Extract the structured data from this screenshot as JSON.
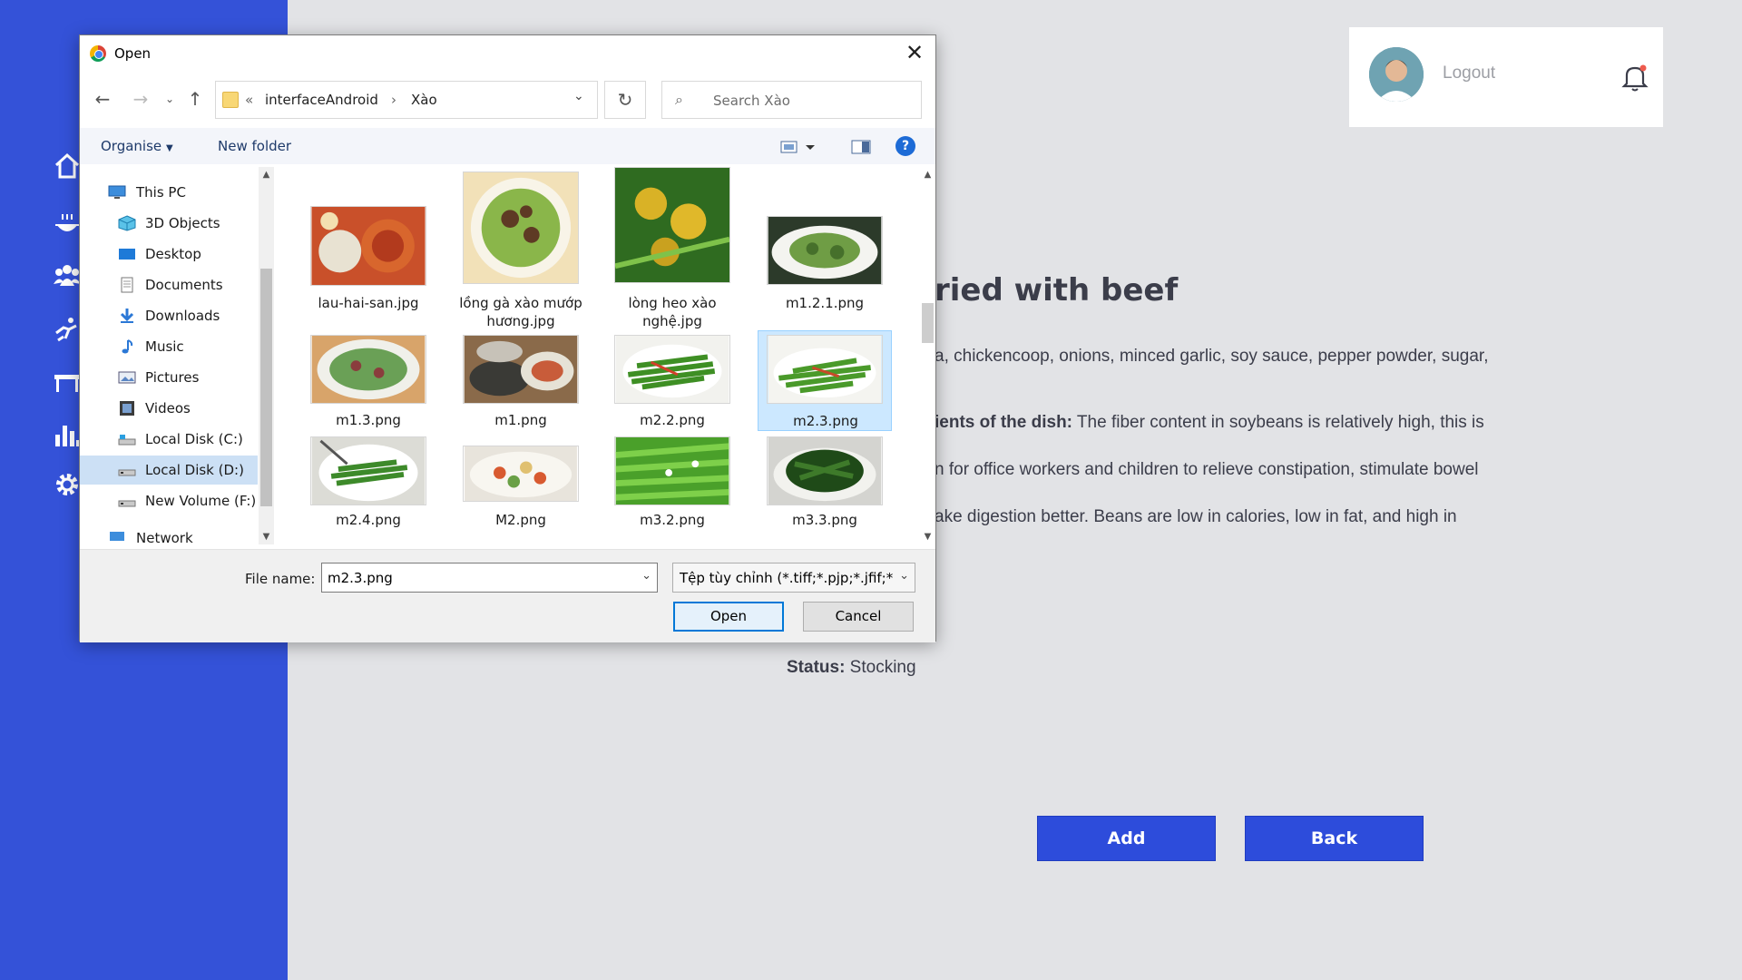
{
  "app": {
    "user_card": {
      "logout_label": "Logout"
    },
    "dish": {
      "title_partial": "ried with beef",
      "ingredients_partial": "a, chickencoop, onions, minced garlic, soy sauce, pepper powder, sugar,",
      "benefits_label_partial": "ients of the dish:",
      "benefits_line1": " The fiber  content in  soybeans is  relatively high,  this is",
      "benefits_line2": "n for office  workers and  children to relieve  constipation, stimulate bowel",
      "benefits_line3": "ake digestion better. Beans are low in calories, low in fat, and high in",
      "status_label": "Status:",
      "status_value": " Stocking"
    },
    "buttons": {
      "add": "Add",
      "back": "Back"
    },
    "colors": {
      "sidebar": "#3452d8",
      "primary_button": "#2d4cdb",
      "background": "#e2e3e6"
    }
  },
  "dialog": {
    "title": "Open",
    "breadcrumb": [
      "interfaceAndroid",
      "Xào"
    ],
    "search_placeholder": "Search Xào",
    "toolbar": {
      "organise": "Organise",
      "new_folder": "New folder"
    },
    "nav_items": [
      {
        "label": "This PC",
        "icon": "monitor-icon"
      },
      {
        "label": "3D Objects",
        "icon": "cube-icon"
      },
      {
        "label": "Desktop",
        "icon": "desktop-icon"
      },
      {
        "label": "Documents",
        "icon": "document-icon"
      },
      {
        "label": "Downloads",
        "icon": "download-icon"
      },
      {
        "label": "Music",
        "icon": "music-icon"
      },
      {
        "label": "Pictures",
        "icon": "pictures-icon"
      },
      {
        "label": "Videos",
        "icon": "video-icon"
      },
      {
        "label": "Local Disk (C:)",
        "icon": "drive-icon"
      },
      {
        "label": "Local Disk (D:)",
        "icon": "drive-icon",
        "selected": true
      },
      {
        "label": "New Volume (F:)",
        "icon": "drive-icon"
      },
      {
        "label": "Network",
        "icon": "network-icon"
      }
    ],
    "files": [
      {
        "name": "lau-hai-san.jpg"
      },
      {
        "name": "lồng gà xào mướp hương.jpg"
      },
      {
        "name": "lòng heo xào nghệ.jpg"
      },
      {
        "name": "m1.2.1.png"
      },
      {
        "name": "m1.3.png"
      },
      {
        "name": "m1.png"
      },
      {
        "name": "m2.2.png"
      },
      {
        "name": "m2.3.png",
        "selected": true
      },
      {
        "name": "m2.4.png"
      },
      {
        "name": "M2.png"
      },
      {
        "name": "m3.2.png"
      },
      {
        "name": "m3.3.png"
      }
    ],
    "file_name_label": "File name:",
    "file_name_value": "m2.3.png",
    "file_type_value": "Tệp tùy chỉnh (*.tiff;*.pjp;*.jfif;*",
    "open_button": "Open",
    "cancel_button": "Cancel"
  }
}
